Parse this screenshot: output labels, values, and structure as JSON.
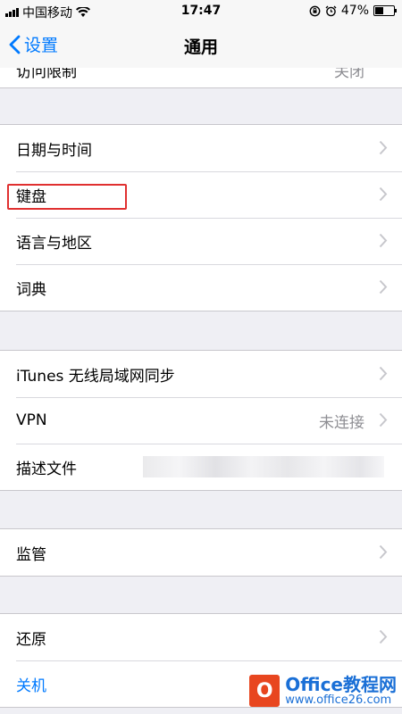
{
  "status": {
    "carrier": "中国移动",
    "time": "17:47",
    "battery": "47%",
    "battery_level": 0.47
  },
  "nav": {
    "back_label": "设置",
    "title": "通用"
  },
  "cut_row": {
    "label": "访问限制",
    "value": "关闭"
  },
  "group1": [
    {
      "label": "日期与时间"
    },
    {
      "label": "键盘"
    },
    {
      "label": "语言与地区"
    },
    {
      "label": "词典"
    }
  ],
  "group2": [
    {
      "label": "iTunes 无线局域网同步",
      "value": ""
    },
    {
      "label": "VPN",
      "value": "未连接"
    },
    {
      "label": "描述文件",
      "value": ""
    }
  ],
  "group3": [
    {
      "label": "监管"
    }
  ],
  "group4": [
    {
      "label": "还原"
    },
    {
      "label": "关机"
    }
  ],
  "watermark": {
    "logo": "O",
    "top": "Office教程网",
    "bottom": "www.office26.com"
  },
  "colors": {
    "accent": "#007aff",
    "highlight": "#e03030"
  }
}
